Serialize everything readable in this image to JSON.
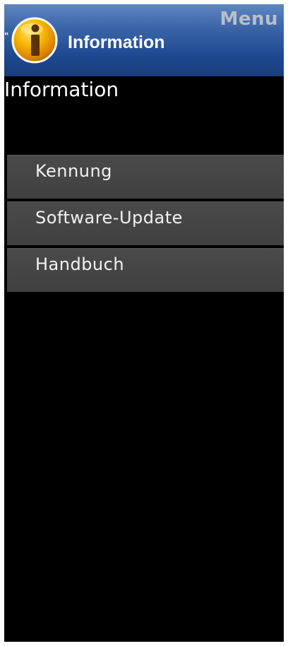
{
  "header": {
    "menu_label": "Menu",
    "title": "Information",
    "icon": "info-icon",
    "accent_colors": [
      "#1e4a91",
      "#f2a900"
    ]
  },
  "page": {
    "title": "Information"
  },
  "menu": {
    "items": [
      {
        "label": "Kennung"
      },
      {
        "label": "Software-Update"
      },
      {
        "label": "Handbuch"
      }
    ]
  }
}
